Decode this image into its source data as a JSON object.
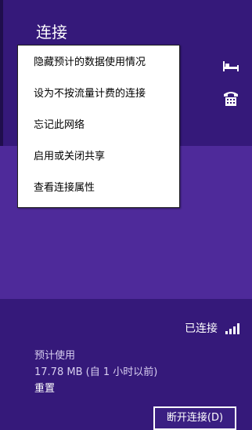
{
  "panel": {
    "title": "连接",
    "accent_color": "#35197a"
  },
  "icons": {
    "bed": "bed-icon",
    "phone": "phone-icon",
    "signal": "wifi-signal-icon"
  },
  "network": {
    "status": "已连接",
    "usage_label": "预计使用",
    "usage_value": "17.78 MB (自 1 小时以前)",
    "reset": "重置",
    "disconnect": "断开连接(D)"
  },
  "context_menu": {
    "items": [
      {
        "label": "隐藏预计的数据使用情况"
      },
      {
        "label": "设为不按流量计费的连接"
      },
      {
        "label": "忘记此网络"
      },
      {
        "label": "启用或关闭共享"
      },
      {
        "label": "查看连接属性"
      }
    ]
  }
}
